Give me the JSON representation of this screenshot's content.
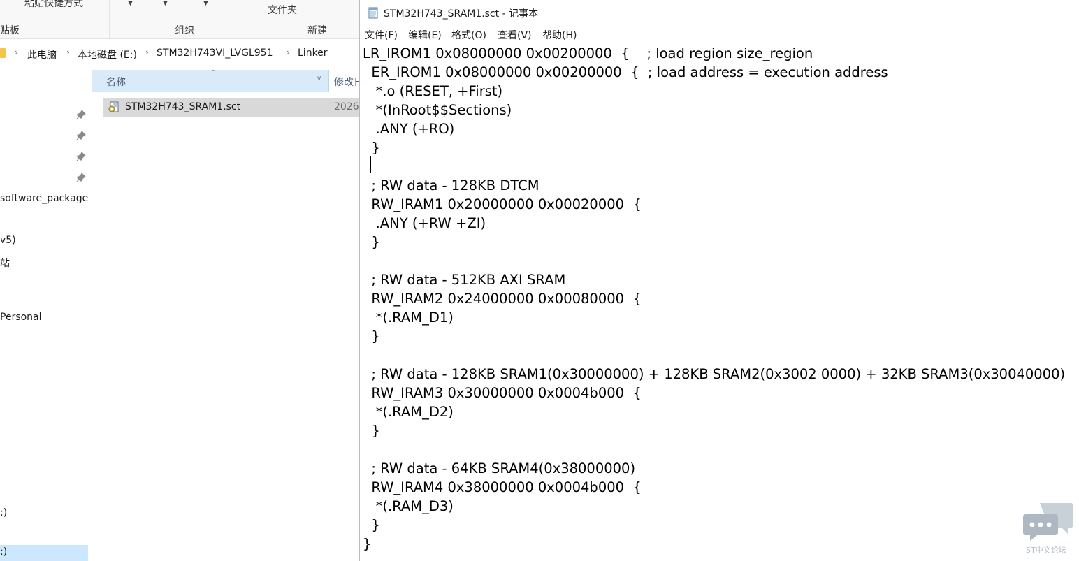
{
  "explorer": {
    "ribbon": {
      "paste_shortcut": "粘贴快捷方式",
      "clipboard_group": "贴板",
      "organize_group": "组织",
      "new_group": "新建",
      "new_folder": "文件夹"
    },
    "breadcrumb": [
      "此电脑",
      "本地磁盘 (E:)",
      "STM32H743VI_LVGL951",
      "Linker"
    ],
    "nav_items": [
      "software_package",
      "v5)",
      "站",
      "Personal",
      ":)",
      ":)"
    ],
    "columns": {
      "name": "名称",
      "modified": "修改日"
    },
    "files": [
      {
        "name": "STM32H743_SRAM1.sct",
        "date": "2026"
      }
    ]
  },
  "notepad": {
    "title": "STM32H743_SRAM1.sct - 记事本",
    "menu": [
      "文件(F)",
      "编辑(E)",
      "格式(O)",
      "查看(V)",
      "帮助(H)"
    ],
    "lines": [
      "LR_IROM1 0x08000000 0x00200000  {    ; load region size_region",
      "  ER_IROM1 0x08000000 0x00200000  {  ; load address = execution address",
      "   *.o (RESET, +First)",
      "   *(InRoot$$Sections)",
      "   .ANY (+RO)",
      "  }",
      "",
      "  ; RW data - 128KB DTCM",
      "  RW_IRAM1 0x20000000 0x00020000  {",
      "   .ANY (+RW +ZI)",
      "  }",
      "",
      "  ; RW data - 512KB AXI SRAM",
      "  RW_IRAM2 0x24000000 0x00080000  {",
      "   *(.RAM_D1)",
      "  }",
      "",
      "  ; RW data - 128KB SRAM1(0x30000000) + 128KB SRAM2(0x3002 0000) + 32KB SRAM3(0x30040000)",
      "  RW_IRAM3 0x30000000 0x0004b000  {",
      "   *(.RAM_D2)",
      "  }",
      "",
      "  ; RW data - 64KB SRAM4(0x38000000)",
      "  RW_IRAM4 0x38000000 0x0004b000  {",
      "   *(.RAM_D3)",
      "  }",
      "}"
    ]
  },
  "watermark": {
    "text": "ST中文论坛"
  },
  "colors": {
    "selection": "#cce8ff",
    "header": "#d9ebf9",
    "file_row": "#d9d9d9"
  }
}
